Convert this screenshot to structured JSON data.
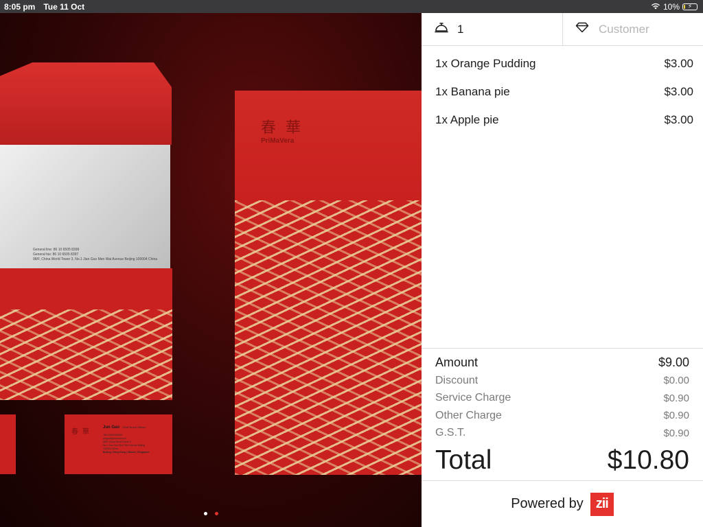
{
  "status_bar": {
    "time": "8:05 pm",
    "date": "Tue 11 Oct",
    "battery_percent": "10%",
    "battery_level": 0.1
  },
  "hero": {
    "envelope_text": [
      "General line: 86 10 6505 8399",
      "General fax: 86 10 6505 8397",
      "98/F, China World Tower 3, No.1 Jian Guo Men Wai Avenue Beijing 100004 China"
    ],
    "logo_cn": "春華",
    "logo_en": "PriMaVera",
    "bizcard_name": "Jun Gao",
    "bizcard_role": "Chief Brand Officer",
    "bizcard_lines": [
      "+86 13901050000",
      "jungao@primavera.cn",
      "98/F, China World Tower 3",
      "No.1 Jian Guo Men Wai Avenue Beijing",
      "100004 China"
    ],
    "bizcard_cities": "Beijing | Hong Kong | Macao | Singapore",
    "page_dots": 2,
    "active_dot": 1
  },
  "header": {
    "table_icon": "service-bell-icon",
    "table_number": "1",
    "customer_icon": "diamond-icon",
    "customer_placeholder": "Customer"
  },
  "order_items": [
    {
      "label": "1x Orange Pudding",
      "price": "$3.00"
    },
    {
      "label": "1x Banana pie",
      "price": "$3.00"
    },
    {
      "label": "1x Apple pie",
      "price": "$3.00"
    }
  ],
  "summary": {
    "amount_label": "Amount",
    "amount": "$9.00",
    "discount_label": "Discount",
    "discount": "$0.00",
    "service_label": "Service Charge",
    "service": "$0.90",
    "other_label": "Other Charge",
    "other": "$0.90",
    "gst_label": "G.S.T.",
    "gst": "$0.90",
    "total_label": "Total",
    "total": "$10.80"
  },
  "footer": {
    "powered_by": "Powered by",
    "logo_text": "zii"
  },
  "colors": {
    "accent": "#e5322d",
    "panel_bg": "#ffffff",
    "divider": "#dcdcdc",
    "muted_text": "#7a7a7c",
    "placeholder": "#b6b6b8"
  }
}
